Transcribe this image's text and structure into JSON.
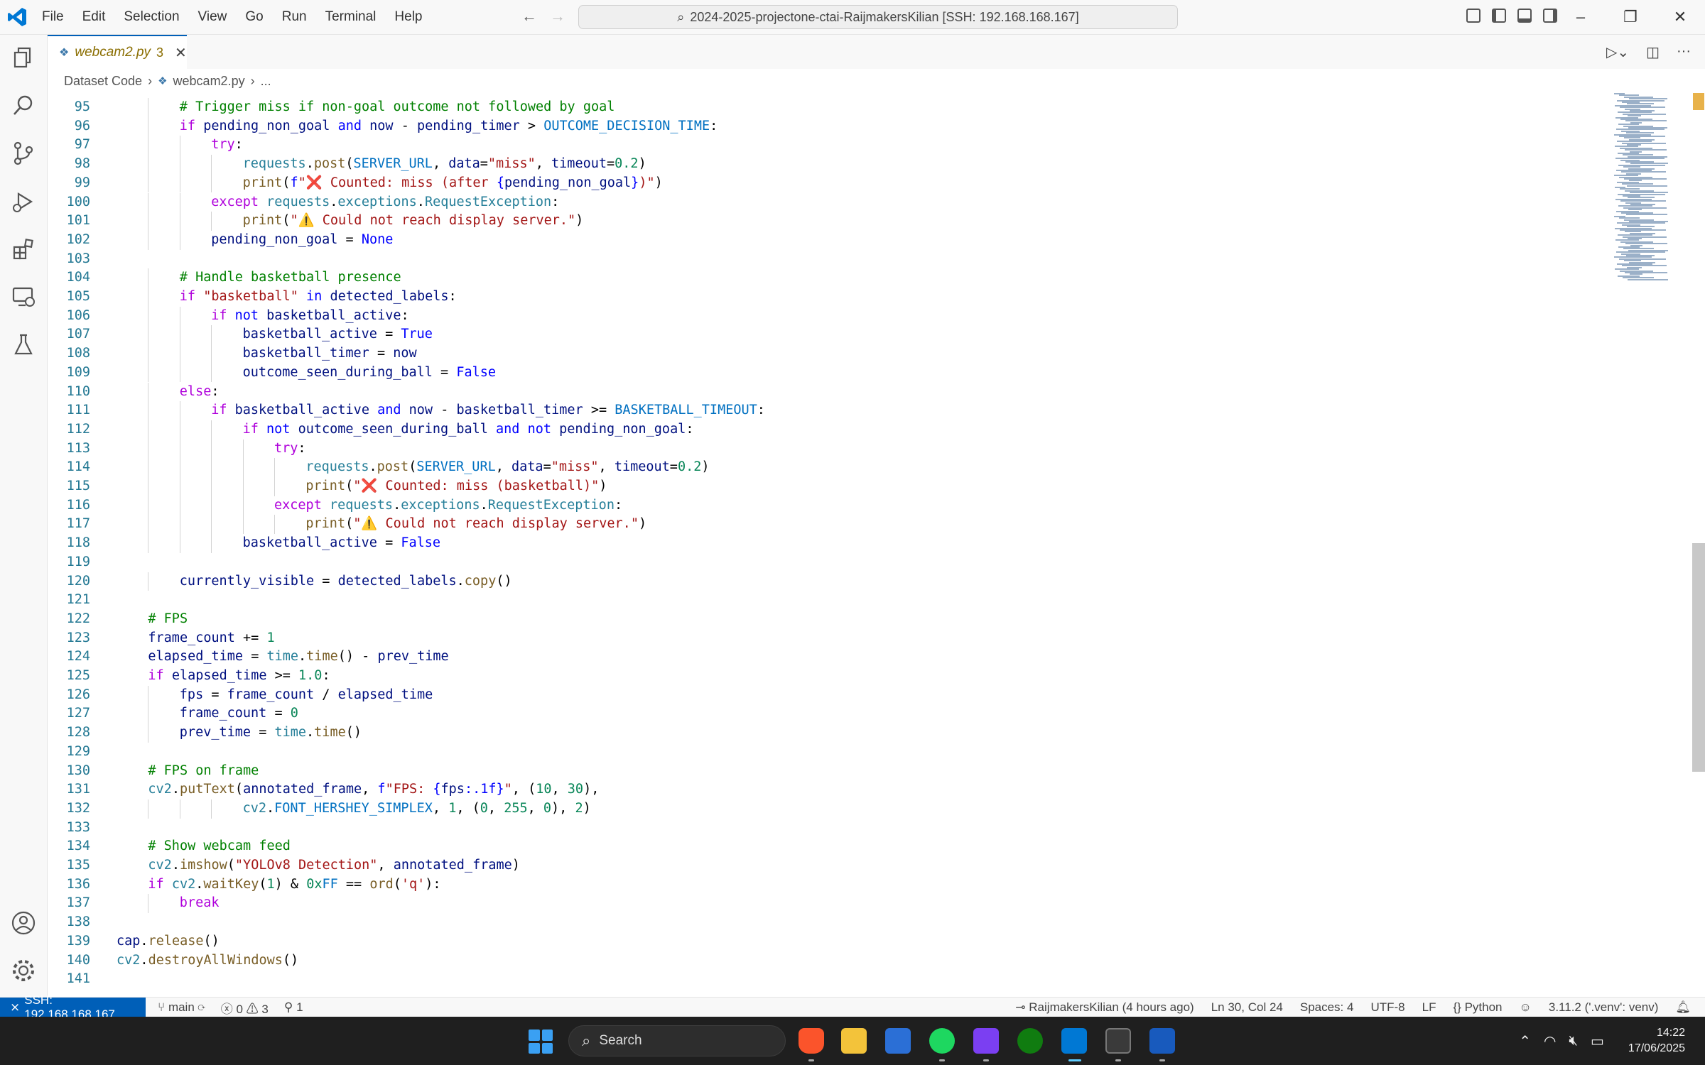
{
  "app": {
    "menu": [
      "File",
      "Edit",
      "Selection",
      "View",
      "Go",
      "Run",
      "Terminal",
      "Help"
    ],
    "command_center": "2024-2025-projectone-ctai-RaijmakersKilian [SSH: 192.168.168.167]"
  },
  "tab": {
    "name": "webcam2.py",
    "problems": "3"
  },
  "breadcrumb": {
    "folder": "Dataset Code",
    "file": "webcam2.py",
    "more": "..."
  },
  "editor": {
    "lines": [
      {
        "n": "95",
        "indent": 2,
        "code": [
          [
            "cm",
            "# Trigger miss if non-goal outcome not followed by goal"
          ]
        ]
      },
      {
        "n": "96",
        "indent": 2,
        "code": [
          [
            "kw",
            "if "
          ],
          [
            "va",
            "pending_non_goal "
          ],
          [
            "bl",
            "and "
          ],
          [
            "va",
            "now "
          ],
          [
            "op",
            "- "
          ],
          [
            "va",
            "pending_timer "
          ],
          [
            "op",
            "> "
          ],
          [
            "cn",
            "OUTCOME_DECISION_TIME"
          ],
          [
            "op",
            ":"
          ]
        ]
      },
      {
        "n": "97",
        "indent": 3,
        "code": [
          [
            "kw",
            "try"
          ],
          [
            "op",
            ":"
          ]
        ]
      },
      {
        "n": "98",
        "indent": 4,
        "code": [
          [
            "cl",
            "requests"
          ],
          [
            "op",
            "."
          ],
          [
            "fn",
            "post"
          ],
          [
            "op",
            "("
          ],
          [
            "cn",
            "SERVER_URL"
          ],
          [
            "op",
            ", "
          ],
          [
            "va",
            "data"
          ],
          [
            "op",
            "="
          ],
          [
            "st",
            "\"miss\""
          ],
          [
            "op",
            ", "
          ],
          [
            "va",
            "timeout"
          ],
          [
            "op",
            "="
          ],
          [
            "nu",
            "0.2"
          ],
          [
            "op",
            ")"
          ]
        ]
      },
      {
        "n": "99",
        "indent": 4,
        "code": [
          [
            "fn",
            "print"
          ],
          [
            "op",
            "("
          ],
          [
            "bl",
            "f"
          ],
          [
            "st",
            "\""
          ],
          [
            "red",
            "❌"
          ],
          [
            "st",
            " Counted: miss (after "
          ],
          [
            "bl",
            "{"
          ],
          [
            "va",
            "pending_non_goal"
          ],
          [
            "bl",
            "}"
          ],
          [
            "st",
            ")\""
          ],
          [
            "op",
            ")"
          ]
        ]
      },
      {
        "n": "100",
        "indent": 3,
        "code": [
          [
            "kw",
            "except "
          ],
          [
            "cl",
            "requests"
          ],
          [
            "op",
            "."
          ],
          [
            "cl",
            "exceptions"
          ],
          [
            "op",
            "."
          ],
          [
            "cl",
            "RequestException"
          ],
          [
            "op",
            ":"
          ]
        ]
      },
      {
        "n": "101",
        "indent": 4,
        "code": [
          [
            "fn",
            "print"
          ],
          [
            "op",
            "("
          ],
          [
            "st",
            "\"⚠️ Could not reach display server.\""
          ],
          [
            "op",
            ")"
          ]
        ]
      },
      {
        "n": "102",
        "indent": 3,
        "code": [
          [
            "va",
            "pending_non_goal "
          ],
          [
            "op",
            "= "
          ],
          [
            "bl",
            "None"
          ]
        ]
      },
      {
        "n": "103",
        "indent": 0,
        "code": []
      },
      {
        "n": "104",
        "indent": 2,
        "code": [
          [
            "cm",
            "# Handle basketball presence"
          ]
        ]
      },
      {
        "n": "105",
        "indent": 2,
        "code": [
          [
            "kw",
            "if "
          ],
          [
            "st",
            "\"basketball\" "
          ],
          [
            "bl",
            "in "
          ],
          [
            "va",
            "detected_labels"
          ],
          [
            "op",
            ":"
          ]
        ]
      },
      {
        "n": "106",
        "indent": 3,
        "code": [
          [
            "kw",
            "if "
          ],
          [
            "bl",
            "not "
          ],
          [
            "va",
            "basketball_active"
          ],
          [
            "op",
            ":"
          ]
        ]
      },
      {
        "n": "107",
        "indent": 4,
        "code": [
          [
            "va",
            "basketball_active "
          ],
          [
            "op",
            "= "
          ],
          [
            "bl",
            "True"
          ]
        ]
      },
      {
        "n": "108",
        "indent": 4,
        "code": [
          [
            "va",
            "basketball_timer "
          ],
          [
            "op",
            "= "
          ],
          [
            "va",
            "now"
          ]
        ]
      },
      {
        "n": "109",
        "indent": 4,
        "code": [
          [
            "va",
            "outcome_seen_during_ball "
          ],
          [
            "op",
            "= "
          ],
          [
            "bl",
            "False"
          ]
        ]
      },
      {
        "n": "110",
        "indent": 2,
        "code": [
          [
            "kw",
            "else"
          ],
          [
            "op",
            ":"
          ]
        ]
      },
      {
        "n": "111",
        "indent": 3,
        "code": [
          [
            "kw",
            "if "
          ],
          [
            "va",
            "basketball_active "
          ],
          [
            "bl",
            "and "
          ],
          [
            "va",
            "now "
          ],
          [
            "op",
            "- "
          ],
          [
            "va",
            "basketball_timer "
          ],
          [
            "op",
            ">= "
          ],
          [
            "cn",
            "BASKETBALL_TIMEOUT"
          ],
          [
            "op",
            ":"
          ]
        ]
      },
      {
        "n": "112",
        "indent": 4,
        "code": [
          [
            "kw",
            "if "
          ],
          [
            "bl",
            "not "
          ],
          [
            "va",
            "outcome_seen_during_ball "
          ],
          [
            "bl",
            "and not "
          ],
          [
            "va",
            "pending_non_goal"
          ],
          [
            "op",
            ":"
          ]
        ]
      },
      {
        "n": "113",
        "indent": 5,
        "code": [
          [
            "kw",
            "try"
          ],
          [
            "op",
            ":"
          ]
        ]
      },
      {
        "n": "114",
        "indent": 6,
        "code": [
          [
            "cl",
            "requests"
          ],
          [
            "op",
            "."
          ],
          [
            "fn",
            "post"
          ],
          [
            "op",
            "("
          ],
          [
            "cn",
            "SERVER_URL"
          ],
          [
            "op",
            ", "
          ],
          [
            "va",
            "data"
          ],
          [
            "op",
            "="
          ],
          [
            "st",
            "\"miss\""
          ],
          [
            "op",
            ", "
          ],
          [
            "va",
            "timeout"
          ],
          [
            "op",
            "="
          ],
          [
            "nu",
            "0.2"
          ],
          [
            "op",
            ")"
          ]
        ]
      },
      {
        "n": "115",
        "indent": 6,
        "code": [
          [
            "fn",
            "print"
          ],
          [
            "op",
            "("
          ],
          [
            "st",
            "\""
          ],
          [
            "red",
            "❌"
          ],
          [
            "st",
            " Counted: miss (basketball)\""
          ],
          [
            "op",
            ")"
          ]
        ]
      },
      {
        "n": "116",
        "indent": 5,
        "code": [
          [
            "kw",
            "except "
          ],
          [
            "cl",
            "requests"
          ],
          [
            "op",
            "."
          ],
          [
            "cl",
            "exceptions"
          ],
          [
            "op",
            "."
          ],
          [
            "cl",
            "RequestException"
          ],
          [
            "op",
            ":"
          ]
        ]
      },
      {
        "n": "117",
        "indent": 6,
        "code": [
          [
            "fn",
            "print"
          ],
          [
            "op",
            "("
          ],
          [
            "st",
            "\"⚠️ Could not reach display server.\""
          ],
          [
            "op",
            ")"
          ]
        ]
      },
      {
        "n": "118",
        "indent": 4,
        "code": [
          [
            "va",
            "basketball_active "
          ],
          [
            "op",
            "= "
          ],
          [
            "bl",
            "False"
          ]
        ]
      },
      {
        "n": "119",
        "indent": 0,
        "code": []
      },
      {
        "n": "120",
        "indent": 2,
        "code": [
          [
            "va",
            "currently_visible "
          ],
          [
            "op",
            "= "
          ],
          [
            "va",
            "detected_labels"
          ],
          [
            "op",
            "."
          ],
          [
            "fn",
            "copy"
          ],
          [
            "op",
            "()"
          ]
        ]
      },
      {
        "n": "121",
        "indent": 0,
        "code": []
      },
      {
        "n": "122",
        "indent": 1,
        "code": [
          [
            "cm",
            "# FPS"
          ]
        ]
      },
      {
        "n": "123",
        "indent": 1,
        "code": [
          [
            "va",
            "frame_count "
          ],
          [
            "op",
            "+= "
          ],
          [
            "nu",
            "1"
          ]
        ]
      },
      {
        "n": "124",
        "indent": 1,
        "code": [
          [
            "va",
            "elapsed_time "
          ],
          [
            "op",
            "= "
          ],
          [
            "cl",
            "time"
          ],
          [
            "op",
            "."
          ],
          [
            "fn",
            "time"
          ],
          [
            "op",
            "() - "
          ],
          [
            "va",
            "prev_time"
          ]
        ]
      },
      {
        "n": "125",
        "indent": 1,
        "code": [
          [
            "kw",
            "if "
          ],
          [
            "va",
            "elapsed_time "
          ],
          [
            "op",
            ">= "
          ],
          [
            "nu",
            "1.0"
          ],
          [
            "op",
            ":"
          ]
        ]
      },
      {
        "n": "126",
        "indent": 2,
        "code": [
          [
            "va",
            "fps "
          ],
          [
            "op",
            "= "
          ],
          [
            "va",
            "frame_count "
          ],
          [
            "op",
            "/ "
          ],
          [
            "va",
            "elapsed_time"
          ]
        ]
      },
      {
        "n": "127",
        "indent": 2,
        "code": [
          [
            "va",
            "frame_count "
          ],
          [
            "op",
            "= "
          ],
          [
            "nu",
            "0"
          ]
        ]
      },
      {
        "n": "128",
        "indent": 2,
        "code": [
          [
            "va",
            "prev_time "
          ],
          [
            "op",
            "= "
          ],
          [
            "cl",
            "time"
          ],
          [
            "op",
            "."
          ],
          [
            "fn",
            "time"
          ],
          [
            "op",
            "()"
          ]
        ]
      },
      {
        "n": "129",
        "indent": 0,
        "code": []
      },
      {
        "n": "130",
        "indent": 1,
        "code": [
          [
            "cm",
            "# FPS on frame"
          ]
        ]
      },
      {
        "n": "131",
        "indent": 1,
        "code": [
          [
            "cl",
            "cv2"
          ],
          [
            "op",
            "."
          ],
          [
            "fn",
            "putText"
          ],
          [
            "op",
            "("
          ],
          [
            "va",
            "annotated_frame"
          ],
          [
            "op",
            ", "
          ],
          [
            "bl",
            "f"
          ],
          [
            "st",
            "\"FPS: "
          ],
          [
            "bl",
            "{"
          ],
          [
            "va",
            "fps"
          ],
          [
            "bl",
            ":.1f}"
          ],
          [
            "st",
            "\""
          ],
          [
            "op",
            ", ("
          ],
          [
            "nu",
            "10"
          ],
          [
            "op",
            ", "
          ],
          [
            "nu",
            "30"
          ],
          [
            "op",
            "),"
          ]
        ]
      },
      {
        "n": "132",
        "indent": 4,
        "code": [
          [
            "cl",
            "cv2"
          ],
          [
            "op",
            "."
          ],
          [
            "cn",
            "FONT_HERSHEY_SIMPLEX"
          ],
          [
            "op",
            ", "
          ],
          [
            "nu",
            "1"
          ],
          [
            "op",
            ", ("
          ],
          [
            "nu",
            "0"
          ],
          [
            "op",
            ", "
          ],
          [
            "nu",
            "255"
          ],
          [
            "op",
            ", "
          ],
          [
            "nu",
            "0"
          ],
          [
            "op",
            "), "
          ],
          [
            "nu",
            "2"
          ],
          [
            "op",
            ")"
          ]
        ]
      },
      {
        "n": "133",
        "indent": 0,
        "code": []
      },
      {
        "n": "134",
        "indent": 1,
        "code": [
          [
            "cm",
            "# Show webcam feed"
          ]
        ]
      },
      {
        "n": "135",
        "indent": 1,
        "code": [
          [
            "cl",
            "cv2"
          ],
          [
            "op",
            "."
          ],
          [
            "fn",
            "imshow"
          ],
          [
            "op",
            "("
          ],
          [
            "st",
            "\"YOLOv8 Detection\""
          ],
          [
            "op",
            ", "
          ],
          [
            "va",
            "annotated_frame"
          ],
          [
            "op",
            ")"
          ]
        ]
      },
      {
        "n": "136",
        "indent": 1,
        "code": [
          [
            "kw",
            "if "
          ],
          [
            "cl",
            "cv2"
          ],
          [
            "op",
            "."
          ],
          [
            "fn",
            "waitKey"
          ],
          [
            "op",
            "("
          ],
          [
            "nu",
            "1"
          ],
          [
            "op",
            ") & "
          ],
          [
            "nu",
            "0x"
          ],
          [
            "cn",
            "FF "
          ],
          [
            "op",
            "== "
          ],
          [
            "fn",
            "ord"
          ],
          [
            "op",
            "("
          ],
          [
            "st",
            "'q'"
          ],
          [
            "op",
            "):"
          ]
        ]
      },
      {
        "n": "137",
        "indent": 2,
        "code": [
          [
            "kw",
            "break"
          ]
        ]
      },
      {
        "n": "138",
        "indent": 0,
        "code": []
      },
      {
        "n": "139",
        "indent": 0,
        "code": [
          [
            "va",
            "cap"
          ],
          [
            "op",
            "."
          ],
          [
            "fn",
            "release"
          ],
          [
            "op",
            "()"
          ]
        ]
      },
      {
        "n": "140",
        "indent": 0,
        "code": [
          [
            "cl",
            "cv2"
          ],
          [
            "op",
            "."
          ],
          [
            "fn",
            "destroyAllWindows"
          ],
          [
            "op",
            "()"
          ]
        ]
      },
      {
        "n": "141",
        "indent": 0,
        "code": []
      }
    ]
  },
  "statusbar": {
    "remote": "SSH: 192.168.168.167",
    "branch": "main",
    "errors": "0",
    "warnings": "3",
    "ports": "1",
    "blame": "RaijmakersKilian (4 hours ago)",
    "cursor": "Ln 30, Col 24",
    "spaces": "Spaces: 4",
    "encoding": "UTF-8",
    "eol": "LF",
    "language": "Python",
    "interpreter": "3.11.2 ('.venv': venv)"
  },
  "taskbar": {
    "search": "Search",
    "time": "14:22",
    "date": "17/06/2025"
  },
  "colors": {
    "accent": "#005fb8",
    "remote_bg": "#005fb8",
    "taskbar_bg": "#1f1f1f"
  }
}
